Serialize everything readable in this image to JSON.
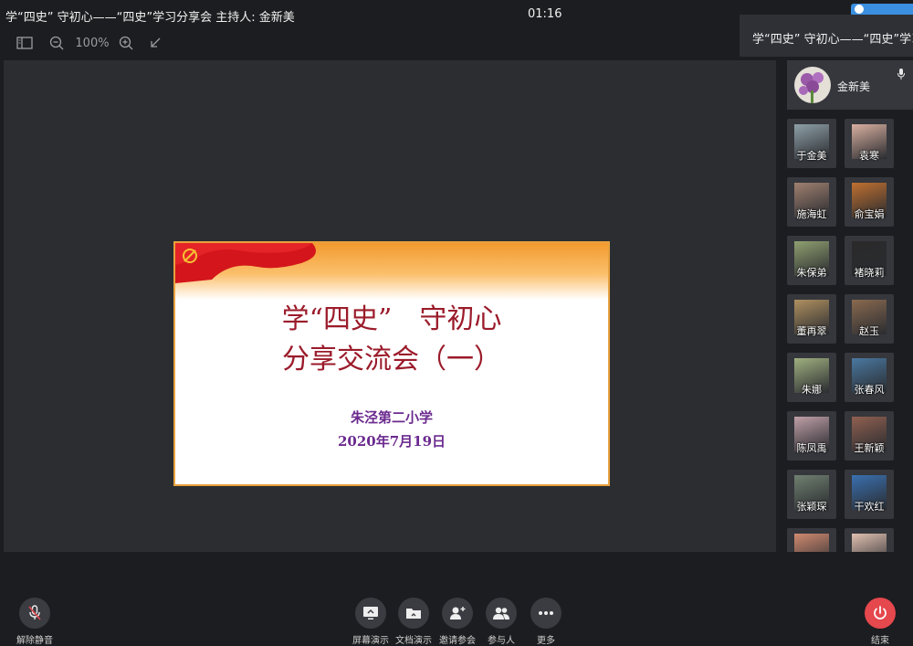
{
  "window": {
    "title": "学“四史” 守初心——“四史”学习分享会   主持人: 金新美",
    "clock": "01:16"
  },
  "toolbar": {
    "zoom": "100%"
  },
  "slide": {
    "title_line1": "学“四史”　守初心",
    "title_line2": "分享交流会（一）",
    "school": "朱泾第二小学",
    "date": "2020年7月19日"
  },
  "side_panel": {
    "header": "学“四史” 守初心——“四史”学习分享会",
    "host": {
      "name": "金新美"
    },
    "participants": [
      {
        "name": "于金美",
        "color": "#8fa0a8"
      },
      {
        "name": "袁寒",
        "color": "#d9b0a0"
      },
      {
        "name": "施海虹",
        "color": "#a08070"
      },
      {
        "name": "俞宝娟",
        "color": "#c07030"
      },
      {
        "name": "朱保弟",
        "color": "#90a070"
      },
      {
        "name": "褚晓莉",
        "color": "#2a2a2a"
      },
      {
        "name": "董再翠",
        "color": "#b09060"
      },
      {
        "name": "赵玉",
        "color": "#8a6a50"
      },
      {
        "name": "朱娜",
        "color": "#a0b080"
      },
      {
        "name": "张春风",
        "color": "#4a78a0"
      },
      {
        "name": "陈凤禹",
        "color": "#c0a0a8"
      },
      {
        "name": "王新颖",
        "color": "#906050"
      },
      {
        "name": "张颖琛",
        "color": "#708070"
      },
      {
        "name": "干欢红",
        "color": "#3a70b0"
      },
      {
        "name": "",
        "color": "#d08a70"
      },
      {
        "name": "",
        "color": "#e0c0b0"
      }
    ]
  },
  "controls": {
    "mute": "解除静音",
    "screen_share": "屏幕演示",
    "doc_share": "文档演示",
    "invite": "邀请参会",
    "participants": "参与人",
    "more": "更多",
    "end": "结束"
  }
}
